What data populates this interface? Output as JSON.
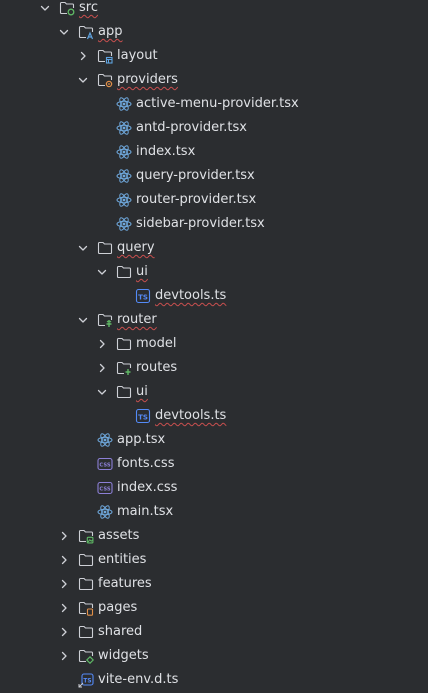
{
  "colors": {
    "background": "#2b2d30",
    "text": "#dfe1e5",
    "folder_outline": "#ced0d6",
    "react": "#6fa8dc",
    "ts_badge": "#548af7",
    "css_badge": "#8c7fd6",
    "error_underline": "#c94f4f",
    "badge_green": "#5fb865",
    "badge_blue": "#5fa3e0",
    "badge_orange": "#e08f48"
  },
  "tree": [
    {
      "label": "src",
      "depth": 1,
      "type": "folder",
      "badge": "src",
      "expanded": true,
      "error": true
    },
    {
      "label": "app",
      "depth": 2,
      "type": "folder",
      "badge": "app",
      "expanded": true,
      "error": true
    },
    {
      "label": "layout",
      "depth": 3,
      "type": "folder",
      "badge": "layout",
      "expanded": false,
      "error": false
    },
    {
      "label": "providers",
      "depth": 3,
      "type": "folder",
      "badge": "providers",
      "expanded": true,
      "error": true
    },
    {
      "label": "active-menu-provider.tsx",
      "depth": 4,
      "type": "react",
      "error": false
    },
    {
      "label": "antd-provider.tsx",
      "depth": 4,
      "type": "react",
      "error": false
    },
    {
      "label": "index.tsx",
      "depth": 4,
      "type": "react",
      "error": false
    },
    {
      "label": "query-provider.tsx",
      "depth": 4,
      "type": "react",
      "error": false
    },
    {
      "label": "router-provider.tsx",
      "depth": 4,
      "type": "react",
      "error": false
    },
    {
      "label": "sidebar-provider.tsx",
      "depth": 4,
      "type": "react",
      "error": false
    },
    {
      "label": "query",
      "depth": 3,
      "type": "folder",
      "expanded": true,
      "error": true
    },
    {
      "label": "ui",
      "depth": 4,
      "type": "folder",
      "expanded": true,
      "error": true
    },
    {
      "label": "devtools.ts",
      "depth": 5,
      "type": "ts",
      "error": true
    },
    {
      "label": "router",
      "depth": 3,
      "type": "folder",
      "badge": "router",
      "expanded": true,
      "error": true
    },
    {
      "label": "model",
      "depth": 4,
      "type": "folder",
      "expanded": false,
      "error": false
    },
    {
      "label": "routes",
      "depth": 4,
      "type": "folder",
      "badge": "routes",
      "expanded": false,
      "error": false
    },
    {
      "label": "ui",
      "depth": 4,
      "type": "folder",
      "expanded": true,
      "error": true
    },
    {
      "label": "devtools.ts",
      "depth": 5,
      "type": "ts",
      "error": true
    },
    {
      "label": "app.tsx",
      "depth": 3,
      "type": "react",
      "error": false
    },
    {
      "label": "fonts.css",
      "depth": 3,
      "type": "css",
      "error": false
    },
    {
      "label": "index.css",
      "depth": 3,
      "type": "css",
      "error": false
    },
    {
      "label": "main.tsx",
      "depth": 3,
      "type": "react",
      "error": false
    },
    {
      "label": "assets",
      "depth": 2,
      "type": "folder",
      "badge": "assets",
      "expanded": false,
      "error": false
    },
    {
      "label": "entities",
      "depth": 2,
      "type": "folder",
      "expanded": false,
      "error": false
    },
    {
      "label": "features",
      "depth": 2,
      "type": "folder",
      "expanded": false,
      "error": false
    },
    {
      "label": "pages",
      "depth": 2,
      "type": "folder",
      "badge": "pages",
      "expanded": false,
      "error": false
    },
    {
      "label": "shared",
      "depth": 2,
      "type": "folder",
      "expanded": false,
      "error": false
    },
    {
      "label": "widgets",
      "depth": 2,
      "type": "folder",
      "badge": "widgets",
      "expanded": false,
      "error": false
    },
    {
      "label": "vite-env.d.ts",
      "depth": 2,
      "type": "ts-ref",
      "error": false
    }
  ]
}
